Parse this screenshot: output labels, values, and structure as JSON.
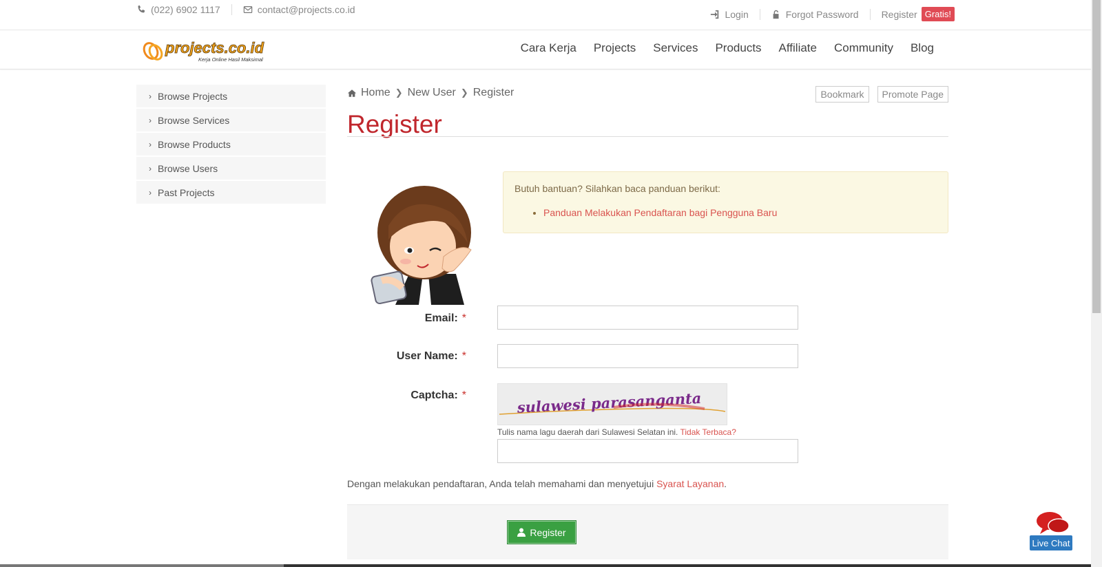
{
  "topbar": {
    "phone": "(022) 6902 1117",
    "email": "contact@projects.co.id",
    "login": "Login",
    "forgot_password": "Forgot Password",
    "register": "Register",
    "gratis": "Gratis!"
  },
  "logo": {
    "text": "projects.co.id",
    "tagline": "Kerja Online Hasil Maksimal"
  },
  "nav": {
    "items": [
      "Cara Kerja",
      "Projects",
      "Services",
      "Products",
      "Affiliate",
      "Community",
      "Blog"
    ]
  },
  "sidebar": {
    "items": [
      "Browse Projects",
      "Browse Services",
      "Browse Products",
      "Browse Users",
      "Past Projects"
    ]
  },
  "breadcrumb": {
    "home": "Home",
    "new_user": "New User",
    "current": "Register"
  },
  "actions": {
    "bookmark": "Bookmark",
    "promote": "Promote Page"
  },
  "page_title": "Register",
  "notice": {
    "text": "Butuh bantuan? Silahkan baca panduan berikut:",
    "link": "Panduan Melakukan Pendaftaran bagi Pengguna Baru"
  },
  "form": {
    "email_label": "Email:",
    "username_label": "User Name:",
    "captcha_label": "Captcha:",
    "required_mark": "*",
    "email_value": "",
    "username_value": "",
    "captcha_value": "",
    "captcha_hint": "Tulis nama lagu daerah dari Sulawesi Selatan ini.",
    "captcha_unreadable": "Tidak Terbaca?",
    "captcha_text": "sulawesi parasanganta"
  },
  "terms": {
    "text": "Dengan melakukan pendaftaran, Anda telah memahami dan menyetujui",
    "link": "Syarat Layanan",
    "end": "."
  },
  "register_button": "Register",
  "livechat": "Live Chat",
  "colors": {
    "accent_red": "#c0272d",
    "link_red": "#d9534f",
    "button_green": "#3aa042",
    "chat_blue": "#2e7ac0"
  }
}
